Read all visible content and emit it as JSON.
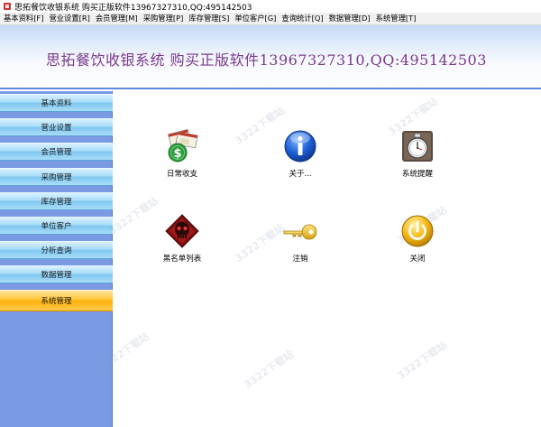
{
  "window": {
    "title": "思拓餐饮收银系统  购买正版软件13967327310,QQ:495142503"
  },
  "menubar": {
    "items": [
      "基本资料[F]",
      "营业设置[R]",
      "会员管理[M]",
      "采购管理[P]",
      "库存管理[S]",
      "单位客户[G]",
      "查询统计[Q]",
      "数据管理[D]",
      "系统管理[T]"
    ]
  },
  "banner": {
    "title": "思拓餐饮收银系统  购买正版软件13967327310,QQ:495142503"
  },
  "sidebar": {
    "items": [
      "基本资料",
      "营业设置",
      "会员管理",
      "采购管理",
      "库存管理",
      "单位客户",
      "分析查询",
      "数据管理",
      "系统管理"
    ],
    "active_index": 8
  },
  "tiles": [
    {
      "label": "日常收支",
      "icon": "daily-income-icon"
    },
    {
      "label": "关于...",
      "icon": "info-icon"
    },
    {
      "label": "系统提醒",
      "icon": "stopwatch-icon"
    },
    {
      "label": "黑名单列表",
      "icon": "blacklist-skull-icon"
    },
    {
      "label": "注销",
      "icon": "key-icon"
    },
    {
      "label": "关闭",
      "icon": "power-icon"
    }
  ],
  "watermark": {
    "text": "3322下载站"
  },
  "colors": {
    "banner_title": "#7a3a8c",
    "sidebar_bg": "#7a9be3",
    "active_item": "#ffb10b"
  }
}
